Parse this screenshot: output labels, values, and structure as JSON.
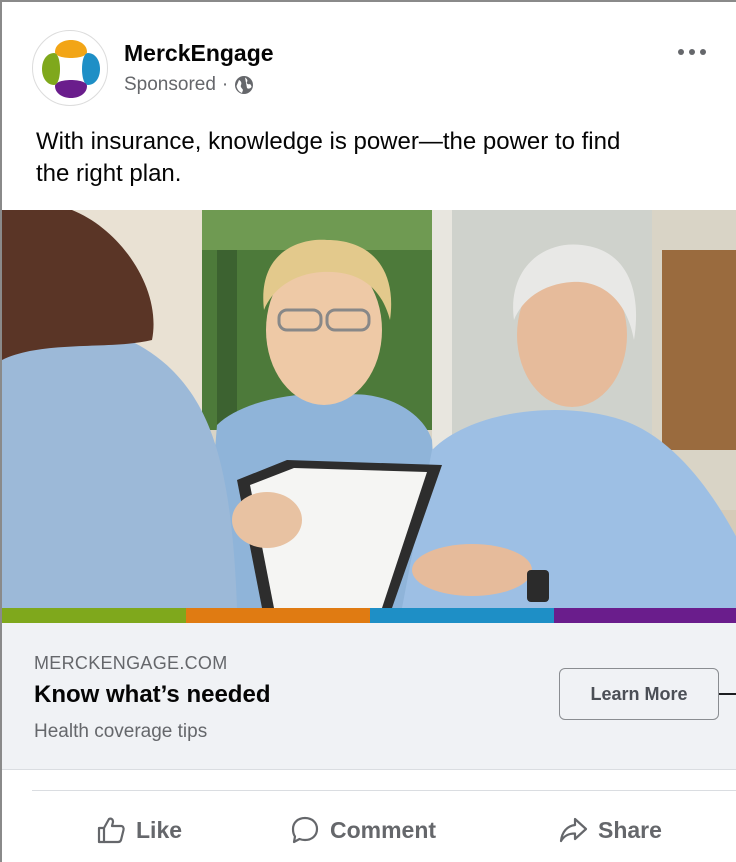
{
  "post": {
    "page_name": "MerckEngage",
    "sponsored_label": "Sponsored",
    "separator": "·",
    "text": "With insurance, knowledge is power—the power to find the right plan."
  },
  "link_preview": {
    "domain": "MERCKENGAGE.COM",
    "headline": "Know what’s needed",
    "description": "Health coverage tips",
    "cta_label": "Learn More"
  },
  "actions": {
    "like": "Like",
    "comment": "Comment",
    "share": "Share"
  },
  "colors": {
    "brand_green": "#7fa81c",
    "brand_orange": "#e07b12",
    "brand_blue": "#1e8fc6",
    "brand_purple": "#6a1d8c",
    "secondary_text": "#65676b",
    "preview_bg": "#f0f2f5"
  },
  "icons": {
    "audience": "globe-icon",
    "menu": "more-options-icon",
    "like": "thumbs-up-icon",
    "comment": "speech-bubble-icon",
    "share": "share-arrow-icon"
  }
}
